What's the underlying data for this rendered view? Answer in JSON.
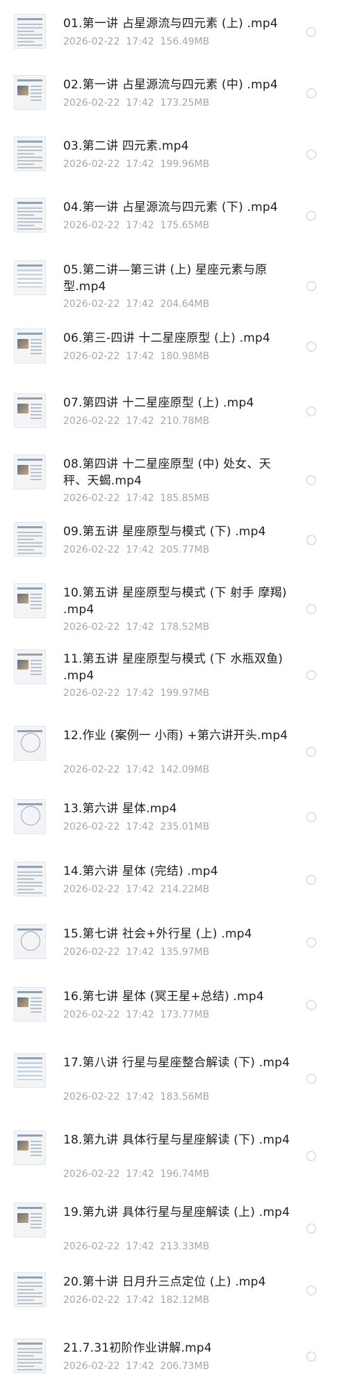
{
  "files": [
    {
      "name": "01.第一讲 占星源流与四元素 (上) .mp4",
      "date": "2026-02-22",
      "time": "17:42",
      "size": "156.49MB",
      "thumb": "doc"
    },
    {
      "name": "02.第一讲 占星源流与四元素 (中) .mp4",
      "date": "2026-02-22",
      "time": "17:42",
      "size": "173.25MB",
      "thumb": "photo"
    },
    {
      "name": "03.第二讲 四元素.mp4",
      "date": "2026-02-22",
      "time": "17:42",
      "size": "199.96MB",
      "thumb": "doc"
    },
    {
      "name": "04.第一讲 占星源流与四元素 (下) .mp4",
      "date": "2026-02-22",
      "time": "17:42",
      "size": "175.65MB",
      "thumb": "doc"
    },
    {
      "name": "05.第二讲—第三讲 (上) 星座元素与原型.mp4",
      "date": "2026-02-22",
      "time": "17:42",
      "size": "204.64MB",
      "thumb": "table"
    },
    {
      "name": "06.第三-四讲 十二星座原型 (上) .mp4",
      "date": "2026-02-22",
      "time": "17:42",
      "size": "180.98MB",
      "thumb": "photo"
    },
    {
      "name": "07.第四讲 十二星座原型 (上) .mp4",
      "date": "2026-02-22",
      "time": "17:42",
      "size": "210.78MB",
      "thumb": "photo"
    },
    {
      "name": "08.第四讲 十二星座原型 (中) 处女、天秤、天蝎.mp4",
      "date": "2026-02-22",
      "time": "17:42",
      "size": "185.85MB",
      "thumb": "photo"
    },
    {
      "name": "09.第五讲 星座原型与模式 (下) .mp4",
      "date": "2026-02-22",
      "time": "17:42",
      "size": "205.77MB",
      "thumb": "doc"
    },
    {
      "name": "10.第五讲 星座原型与模式 (下 射手 摩羯) .mp4",
      "date": "2026-02-22",
      "time": "17:42",
      "size": "178.52MB",
      "thumb": "photo"
    },
    {
      "name": "11.第五讲 星座原型与模式 (下 水瓶双鱼) .mp4",
      "date": "2026-02-22",
      "time": "17:42",
      "size": "199.97MB",
      "thumb": "photo"
    },
    {
      "name": "12.作业 (案例一 小雨) +第六讲开头.mp4",
      "date": "2026-02-22",
      "time": "17:42",
      "size": "142.09MB",
      "thumb": "chart"
    },
    {
      "name": "13.第六讲 星体.mp4",
      "date": "2026-02-22",
      "time": "17:42",
      "size": "235.01MB",
      "thumb": "chart"
    },
    {
      "name": "14.第六讲 星体 (完结) .mp4",
      "date": "2026-02-22",
      "time": "17:42",
      "size": "214.22MB",
      "thumb": "doc"
    },
    {
      "name": "15.第七讲 社会+外行星 (上) .mp4",
      "date": "2026-02-22",
      "time": "17:42",
      "size": "135.97MB",
      "thumb": "chart"
    },
    {
      "name": "16.第七讲 星体 (冥王星+总结) .mp4",
      "date": "2026-02-22",
      "time": "17:42",
      "size": "173.77MB",
      "thumb": "photo"
    },
    {
      "name": "17.第八讲 行星与星座整合解读 (下) .mp4",
      "date": "2026-02-22",
      "time": "17:42",
      "size": "183.56MB",
      "thumb": "table"
    },
    {
      "name": "18.第九讲 具体行星与星座解读 (下) .mp4",
      "date": "2026-02-22",
      "time": "17:42",
      "size": "196.74MB",
      "thumb": "photo"
    },
    {
      "name": "19.第九讲 具体行星与星座解读 (上) .mp4",
      "date": "2026-02-22",
      "time": "17:42",
      "size": "213.33MB",
      "thumb": "photo"
    },
    {
      "name": "20.第十讲 日月升三点定位 (上) .mp4",
      "date": "2026-02-22",
      "time": "17:42",
      "size": "182.12MB",
      "thumb": "doc"
    },
    {
      "name": "21.7.31初阶作业讲解.mp4",
      "date": "2026-02-22",
      "time": "17:42",
      "size": "206.73MB",
      "thumb": "doc"
    }
  ]
}
